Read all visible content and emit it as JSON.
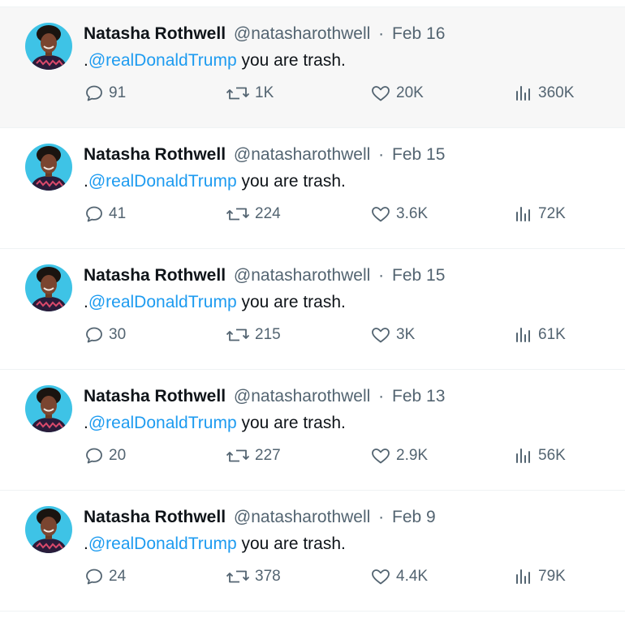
{
  "colors": {
    "mention_blue": "#1d9bf0",
    "secondary_text": "#536471",
    "primary_text": "#0f1419",
    "hover_background": "#f7f7f7",
    "divider": "#eff3f4"
  },
  "icons": {
    "reply": "speech-bubble-icon",
    "retweet": "retweet-arrows-icon",
    "like": "heart-outline-icon",
    "views": "bar-chart-icon"
  },
  "tweets": [
    {
      "display_name": "Natasha Rothwell",
      "handle": "@natasharothwell",
      "separator": "·",
      "date": "Feb 16",
      "text_prefix": ".",
      "mention": "@realDonaldTrump",
      "text_rest": " you are trash.",
      "replies": "91",
      "retweets": "1K",
      "likes": "20K",
      "views": "360K"
    },
    {
      "display_name": "Natasha Rothwell",
      "handle": "@natasharothwell",
      "separator": "·",
      "date": "Feb 15",
      "text_prefix": ".",
      "mention": "@realDonaldTrump",
      "text_rest": " you are trash.",
      "replies": "41",
      "retweets": "224",
      "likes": "3.6K",
      "views": "72K"
    },
    {
      "display_name": "Natasha Rothwell",
      "handle": "@natasharothwell",
      "separator": "·",
      "date": "Feb 15",
      "text_prefix": ".",
      "mention": "@realDonaldTrump",
      "text_rest": " you are trash.",
      "replies": "30",
      "retweets": "215",
      "likes": "3K",
      "views": "61K"
    },
    {
      "display_name": "Natasha Rothwell",
      "handle": "@natasharothwell",
      "separator": "·",
      "date": "Feb 13",
      "text_prefix": ".",
      "mention": "@realDonaldTrump",
      "text_rest": " you are trash.",
      "replies": "20",
      "retweets": "227",
      "likes": "2.9K",
      "views": "56K"
    },
    {
      "display_name": "Natasha Rothwell",
      "handle": "@natasharothwell",
      "separator": "·",
      "date": "Feb 9",
      "text_prefix": ".",
      "mention": "@realDonaldTrump",
      "text_rest": " you are trash.",
      "replies": "24",
      "retweets": "378",
      "likes": "4.4K",
      "views": "79K"
    }
  ]
}
